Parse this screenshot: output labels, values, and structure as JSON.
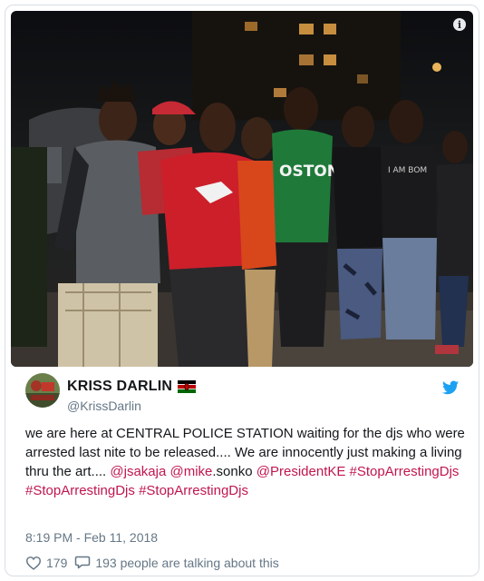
{
  "photo": {
    "info_glyph": "i",
    "jersey_text": "OSTON",
    "shirt_text": "I AM BOM"
  },
  "author": {
    "name": "KRISS DARLIN",
    "handle": "@KrissDarlin"
  },
  "tweet": {
    "segments": [
      {
        "text": "we are here at CENTRAL POLICE STATION waiting for the djs who were arrested last nite to be released.... We are innocently just making a living thru the art.... ",
        "link": false
      },
      {
        "text": "@jsakaja",
        "link": true
      },
      {
        "text": " ",
        "link": false
      },
      {
        "text": "@mike",
        "link": true
      },
      {
        "text": ".sonko ",
        "link": false
      },
      {
        "text": "@PresidentKE",
        "link": true
      },
      {
        "text": " ",
        "link": false
      },
      {
        "text": "#StopArrestingDjs",
        "link": true
      },
      {
        "text": " ",
        "link": false
      },
      {
        "text": "#StopArrestingDjs",
        "link": true
      },
      {
        "text": " ",
        "link": false
      },
      {
        "text": "#StopArrestingDjs",
        "link": true
      }
    ]
  },
  "timestamp": "8:19 PM - Feb 11, 2018",
  "actions": {
    "likes": "179",
    "conversation": "193 people are talking about this"
  },
  "icons": {
    "info": "info-icon",
    "bird": "twitter-bird-icon",
    "flag": "kenya-flag-icon",
    "heart": "heart-icon",
    "reply": "speech-bubble-icon"
  },
  "colors": {
    "link": "#c0164d",
    "meta": "#657786",
    "twitter_blue": "#1da1f2"
  }
}
